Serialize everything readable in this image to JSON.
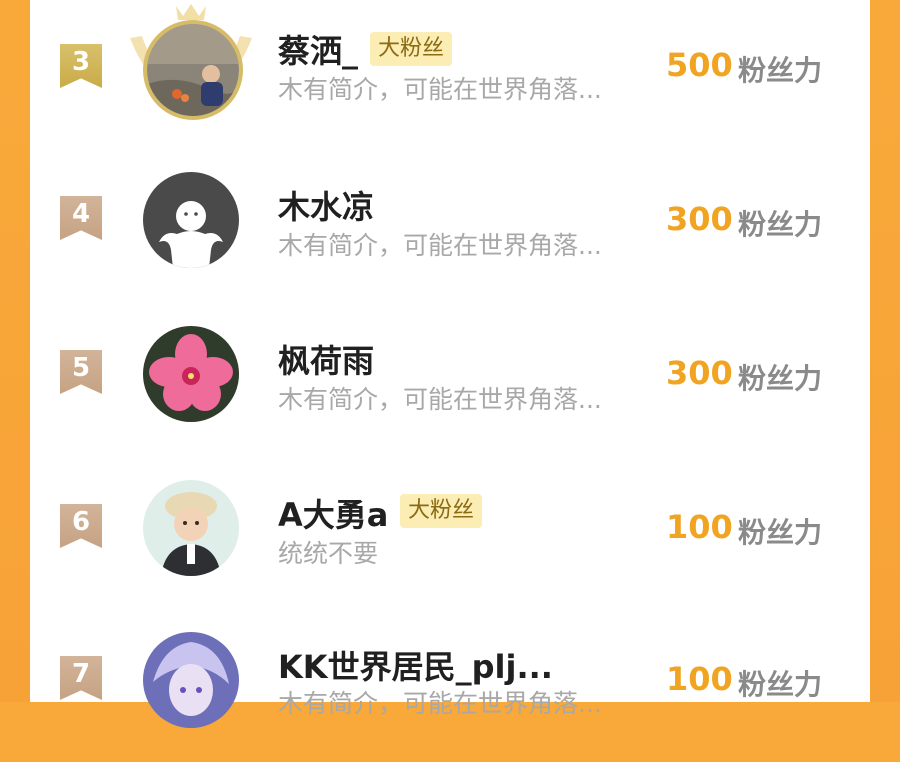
{
  "fans": [
    {
      "rank": "3",
      "name": "蔡洒_",
      "badge": "大粉丝",
      "bio": "木有简介，可能在世界角落...",
      "score": "500",
      "unit": "粉丝力"
    },
    {
      "rank": "4",
      "name": "木水凉",
      "badge": "",
      "bio": "木有简介，可能在世界角落...",
      "score": "300",
      "unit": "粉丝力"
    },
    {
      "rank": "5",
      "name": "枫荷雨",
      "badge": "",
      "bio": "木有简介，可能在世界角落...",
      "score": "300",
      "unit": "粉丝力"
    },
    {
      "rank": "6",
      "name": "A大勇a",
      "badge": "大粉丝",
      "bio": "统统不要",
      "score": "100",
      "unit": "粉丝力"
    },
    {
      "rank": "7",
      "name": "KK世界居民_plj...",
      "badge": "",
      "bio": "木有简介，可能在世界角落...",
      "score": "100",
      "unit": "粉丝力"
    }
  ],
  "colors": {
    "accent": "#f0a422",
    "background": "#f9a93a",
    "badge_bg": "#fbedb4"
  },
  "icons": {
    "rank_ribbon": "ribbon-icon",
    "laurel": "crown-laurel-icon"
  }
}
